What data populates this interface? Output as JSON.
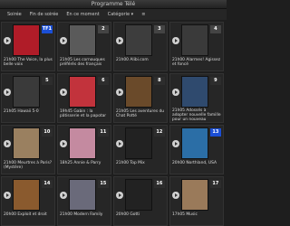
{
  "window": {
    "title": "Programme Télé"
  },
  "toolbar": {
    "items": [
      "Soirée",
      "Fin de soirée",
      "En ce moment",
      "Catégorie ▾",
      "≡"
    ]
  },
  "cards": [
    {
      "time": "21h00",
      "title": "The Voice, la plus belle voix",
      "channel_logo": "TF1",
      "logo_color": "#1b4fd6",
      "thumb_color": "#b01c28"
    },
    {
      "time": "21h05",
      "title": "Les cornouques préférés des français",
      "channel_logo": "2",
      "logo_color": "#444",
      "thumb_color": "#5a5a5a"
    },
    {
      "time": "21h00",
      "title": "Alibi.com",
      "channel_logo": "3",
      "logo_color": "#444",
      "thumb_color": "#3d3d3d"
    },
    {
      "time": "21h00",
      "title": "Alarmes! Agissez et foncé",
      "channel_logo": "4",
      "logo_color": "#444",
      "thumb_color": "#3a3a3a"
    },
    {
      "time": "21h05",
      "title": "Hawaii 5-0",
      "channel_logo": "5",
      "logo_color": "#2d2d2d",
      "thumb_color": "#3a3a3a"
    },
    {
      "time": "19h45",
      "title": "Gabin : la pâtisserie et la papotar",
      "channel_logo": "6",
      "logo_color": "#2d2d2d",
      "thumb_color": "#c2333c"
    },
    {
      "time": "21h05",
      "title": "Les aventures du Chat Potté",
      "channel_logo": "8",
      "logo_color": "#2d2d2d",
      "thumb_color": "#6a4a2a"
    },
    {
      "time": "21h05",
      "title": "Adossés à adopter nouvelle famille pour un nouveau",
      "channel_logo": "9",
      "logo_color": "#2d2d2d",
      "thumb_color": "#2f4a6e"
    },
    {
      "time": "21h00",
      "title": "Meurtres à Paris? (Mystère)",
      "channel_logo": "10",
      "logo_color": "#2d2d2d",
      "thumb_color": "#9a8060"
    },
    {
      "time": "18h25",
      "title": "Annie & Parry",
      "channel_logo": "11",
      "logo_color": "#2d2d2d",
      "thumb_color": "#c48aa0"
    },
    {
      "time": "21h00",
      "title": "Top Mix",
      "channel_logo": "12",
      "logo_color": "#2d2d2d",
      "thumb_color": "#222"
    },
    {
      "time": "20h00",
      "title": "Northland, USA",
      "channel_logo": "13",
      "logo_color": "#1b4fd6",
      "thumb_color": "#2b6ea6"
    },
    {
      "time": "20h00",
      "title": "Exploit et droit",
      "channel_logo": "14",
      "logo_color": "#2d2d2d",
      "thumb_color": "#8a5a2e"
    },
    {
      "time": "21h00",
      "title": "Modern Family",
      "channel_logo": "15",
      "logo_color": "#2d2d2d",
      "thumb_color": "#6a6a7a"
    },
    {
      "time": "20h00",
      "title": "Gotti",
      "channel_logo": "16",
      "logo_color": "#2d2d2d",
      "thumb_color": "#222"
    },
    {
      "time": "17h05",
      "title": "Music",
      "channel_logo": "17",
      "logo_color": "#2d2d2d",
      "thumb_color": "#9a7a5a"
    }
  ]
}
